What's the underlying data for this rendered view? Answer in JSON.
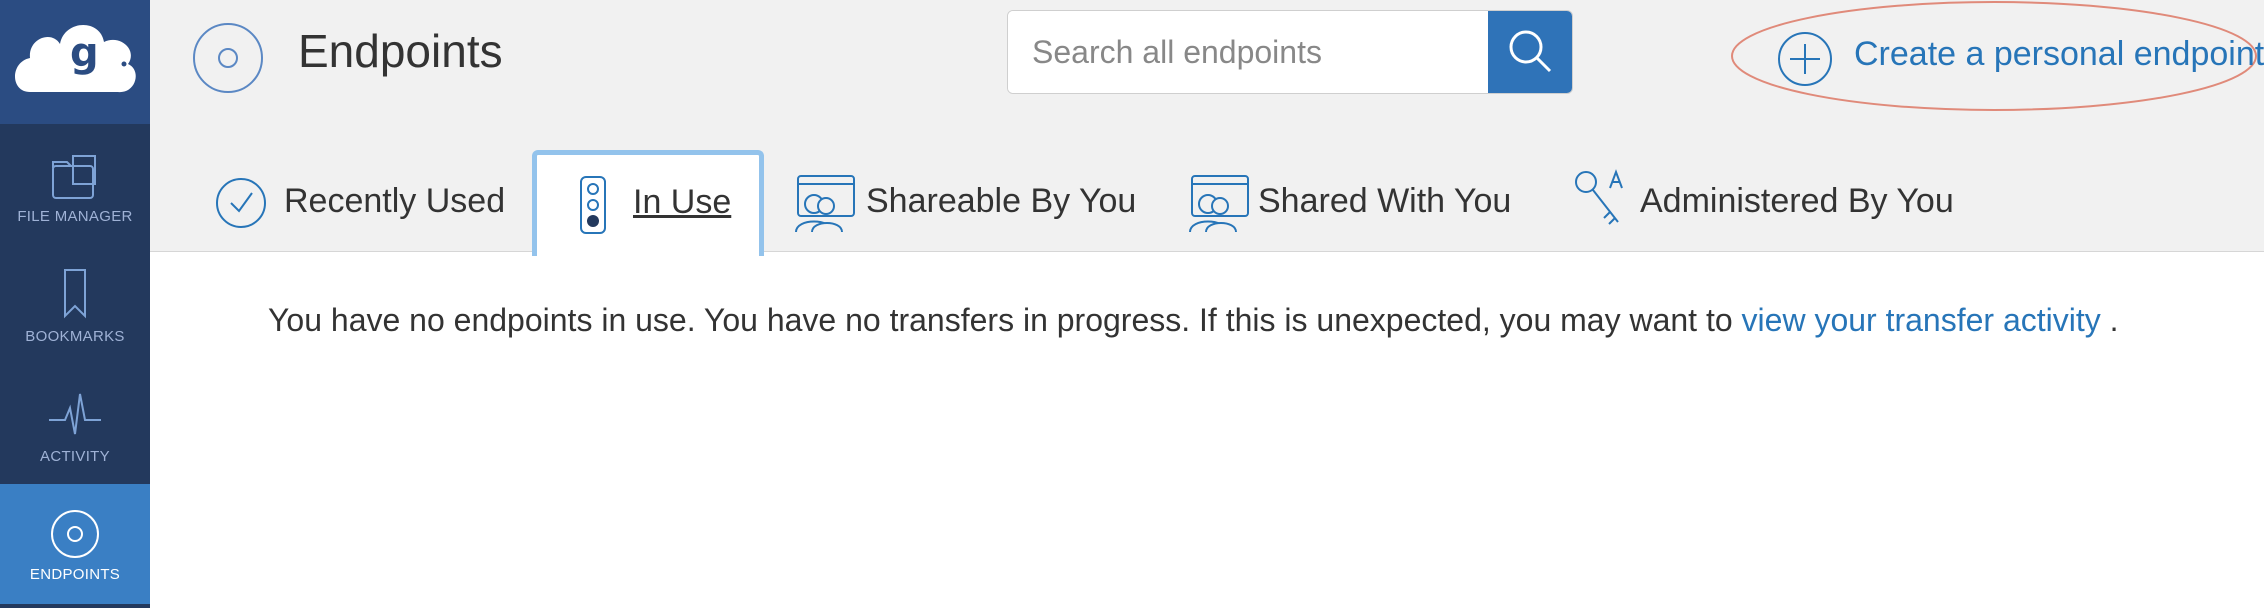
{
  "sidebar": {
    "logo_icon": "globus-cloud-logo",
    "items": [
      {
        "label": "FILE MANAGER",
        "icon": "folder-icon"
      },
      {
        "label": "BOOKMARKS",
        "icon": "bookmark-icon"
      },
      {
        "label": "ACTIVITY",
        "icon": "activity-icon"
      },
      {
        "label": "ENDPOINTS",
        "icon": "endpoint-icon",
        "active": true
      }
    ]
  },
  "header": {
    "title": "Endpoints",
    "title_icon": "endpoint-icon",
    "search": {
      "placeholder": "Search all endpoints",
      "value": ""
    },
    "create_link": "Create a personal endpoint"
  },
  "tabs": [
    {
      "label": "Recently Used",
      "icon": "check-circle-icon"
    },
    {
      "label": "In Use",
      "icon": "traffic-light-icon",
      "active": true
    },
    {
      "label": "Shareable By You",
      "icon": "shared-folder-icon"
    },
    {
      "label": "Shared With You",
      "icon": "shared-folder-icon"
    },
    {
      "label": "Administered By You",
      "icon": "admin-key-icon"
    }
  ],
  "main": {
    "message_text": "You have no endpoints in use. You have no transfers in progress. If this is unexpected, you may want to",
    "message_link": "view your transfer activity",
    "message_end": "."
  },
  "colors": {
    "sidebar_bg": "#23395d",
    "sidebar_active": "#3a7fc4",
    "accent": "#2775b8",
    "highlight_ellipse": "#e08a7a",
    "active_tab_border": "#93c3ec"
  }
}
